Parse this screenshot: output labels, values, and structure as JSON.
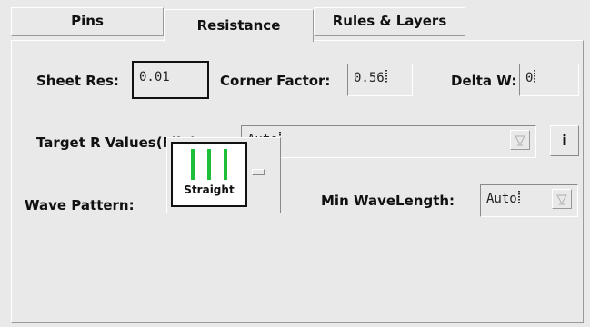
{
  "tabs": [
    {
      "label": "Pins",
      "active": false
    },
    {
      "label": "Resistance",
      "active": true
    },
    {
      "label": "Rules & Layers",
      "active": false
    }
  ],
  "sheet_res": {
    "label": "Sheet Res:",
    "value": "0.01"
  },
  "corner_factor": {
    "label": "Corner Factor:",
    "value": "0.56"
  },
  "delta_w": {
    "label": "Delta W:",
    "value": "0"
  },
  "target_r": {
    "label": "Target R Values(File):",
    "value": "Auto",
    "info_label": "i"
  },
  "wave_pattern": {
    "label": "Wave Pattern:",
    "selected": "Straight"
  },
  "min_wavelength": {
    "label": "Min WaveLength:",
    "value": "Auto"
  },
  "colors": {
    "wave_bars": "#1fbf3a",
    "background": "#e9e9e9"
  },
  "icons": {
    "combo_arrow": "down-triangle-icon",
    "info": "info-icon"
  }
}
